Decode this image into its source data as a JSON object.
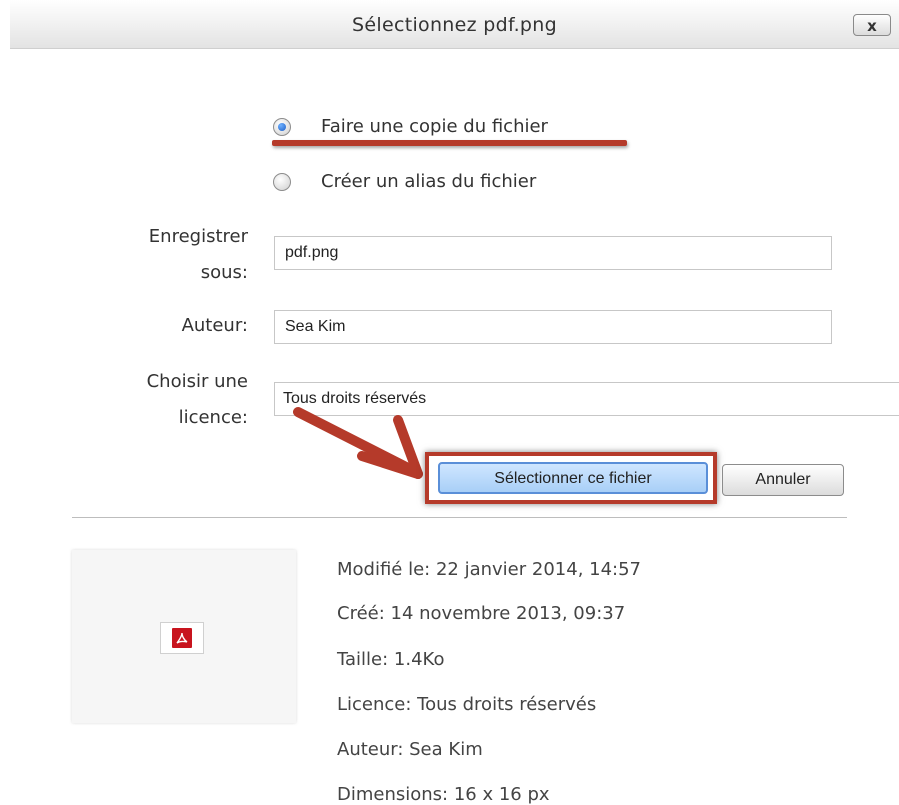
{
  "dialog": {
    "title": "Sélectionnez pdf.png",
    "close_label": "x"
  },
  "options": [
    {
      "label": "Faire une copie du fichier",
      "checked": true
    },
    {
      "label": "Créer un alias du fichier",
      "checked": false
    }
  ],
  "form": {
    "save_as_label_line1": "Enregistrer",
    "save_as_label_line2": "sous:",
    "save_as_value": "pdf.png",
    "author_label": "Auteur:",
    "author_value": "Sea Kim",
    "license_label_line1": "Choisir une",
    "license_label_line2": "licence:",
    "license_value": "Tous droits réservés"
  },
  "buttons": {
    "select_label": "Sélectionner ce fichier",
    "cancel_label": "Annuler"
  },
  "file_info": {
    "modified": "Modifié le: 22 janvier 2014, 14:57",
    "created": "Créé: 14 novembre 2013, 09:37",
    "size": "Taille: 1.4Ko",
    "license": "Licence: Tous droits réservés",
    "author": "Auteur: Sea Kim",
    "dimensions": "Dimensions: 16 x 16 px"
  },
  "colors": {
    "annotation": "#b53a2a",
    "primary_button": "#a8cff7",
    "pdf_icon": "#c8141e"
  }
}
